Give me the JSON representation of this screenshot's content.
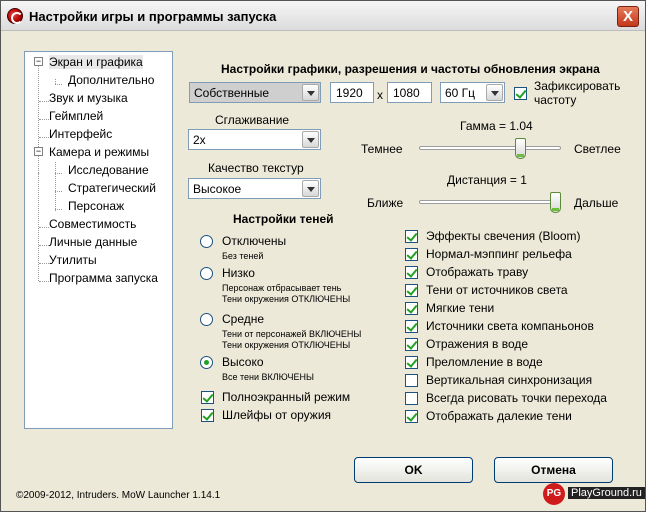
{
  "window": {
    "title": "Настройки игры и программы запуска",
    "close_label": "X"
  },
  "tree": {
    "items": [
      {
        "label": "Экран и графика",
        "expander": "−"
      },
      {
        "label": "Дополнительно"
      },
      {
        "label": "Звук и музыка"
      },
      {
        "label": "Геймплей"
      },
      {
        "label": "Интерфейс"
      },
      {
        "label": "Камера и режимы",
        "expander": "−"
      },
      {
        "label": "Исследование"
      },
      {
        "label": "Стратегический"
      },
      {
        "label": "Персонаж"
      },
      {
        "label": "Совместимость"
      },
      {
        "label": "Личные данные"
      },
      {
        "label": "Утилиты"
      },
      {
        "label": "Программа запуска"
      }
    ]
  },
  "graphics": {
    "heading": "Настройки графики, разрешения и частоты обновления экрана",
    "resolution_mode": "Собственные",
    "width": "1920",
    "x_label": "x",
    "height": "1080",
    "refresh": "60 Гц",
    "lock_refresh_label": "Зафиксировать частоту",
    "lock_refresh_checked": true,
    "antialiasing_label": "Сглаживание",
    "antialiasing_value": "2x",
    "texture_label": "Качество текстур",
    "texture_value": "Высокое",
    "gamma_label": "Гамма = 1.04",
    "gamma_left": "Темнее",
    "gamma_right": "Светлее",
    "gamma_level": 0.73,
    "distance_label": "Дистанция = 1",
    "distance_left": "Ближе",
    "distance_right": "Дальше",
    "distance_level": 1.0
  },
  "shadows": {
    "heading": "Настройки теней",
    "options": [
      {
        "label": "Отключены",
        "desc1": "Без теней",
        "desc2": "",
        "checked": false
      },
      {
        "label": "Низко",
        "desc1": "Персонаж отбрасывает тень",
        "desc2": "Тени окружения ОТКЛЮЧЕНЫ",
        "checked": false
      },
      {
        "label": "Средне",
        "desc1": "Тени от персонажей ВКЛЮЧЕНЫ",
        "desc2": "Тени окружения ОТКЛЮЧЕНЫ",
        "checked": false
      },
      {
        "label": "Высоко",
        "desc1": "Все тени ВКЛЮЧЕНЫ",
        "desc2": "",
        "checked": true
      }
    ]
  },
  "left_checks": [
    {
      "label": "Полноэкранный режим",
      "checked": true
    },
    {
      "label": "Шлейфы от оружия",
      "checked": true
    }
  ],
  "right_checks": [
    {
      "label": "Эффекты свечения (Bloom)",
      "checked": true
    },
    {
      "label": "Нормал-мэппинг рельефа",
      "checked": true
    },
    {
      "label": "Отображать траву",
      "checked": true
    },
    {
      "label": "Тени от источников света",
      "checked": true
    },
    {
      "label": "Мягкие тени",
      "checked": true
    },
    {
      "label": "Источники света компаньонов",
      "checked": true
    },
    {
      "label": "Отражения в воде",
      "checked": true
    },
    {
      "label": "Преломление в воде",
      "checked": true
    },
    {
      "label": "Вертикальная синхронизация",
      "checked": false
    },
    {
      "label": "Всегда рисовать точки перехода",
      "checked": false
    },
    {
      "label": "Отображать далекие тени",
      "checked": true
    }
  ],
  "buttons": {
    "ok": "OK",
    "cancel": "Отмена"
  },
  "footer": "©2009-2012, Intruders. MoW Launcher 1.14.1",
  "watermark": {
    "badge": "PG",
    "text": "PlayGround.ru"
  }
}
